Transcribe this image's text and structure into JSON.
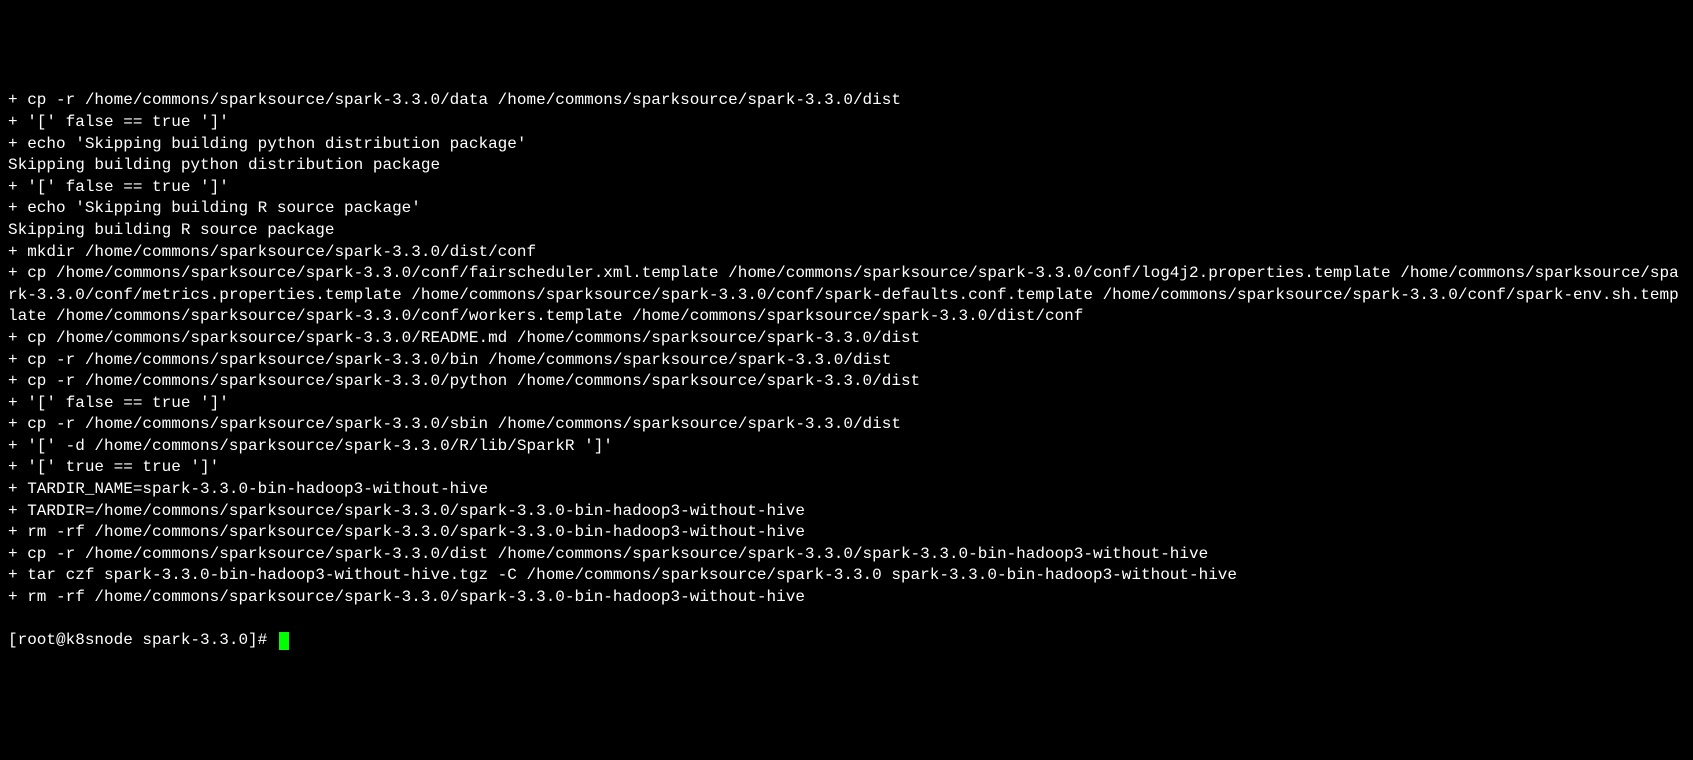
{
  "terminal": {
    "lines": [
      "+ cp -r /home/commons/sparksource/spark-3.3.0/data /home/commons/sparksource/spark-3.3.0/dist",
      "+ '[' false == true ']'",
      "+ echo 'Skipping building python distribution package'",
      "Skipping building python distribution package",
      "+ '[' false == true ']'",
      "+ echo 'Skipping building R source package'",
      "Skipping building R source package",
      "+ mkdir /home/commons/sparksource/spark-3.3.0/dist/conf",
      "+ cp /home/commons/sparksource/spark-3.3.0/conf/fairscheduler.xml.template /home/commons/sparksource/spark-3.3.0/conf/log4j2.properties.template /home/commons/sparksource/spark-3.3.0/conf/metrics.properties.template /home/commons/sparksource/spark-3.3.0/conf/spark-defaults.conf.template /home/commons/sparksource/spark-3.3.0/conf/spark-env.sh.template /home/commons/sparksource/spark-3.3.0/conf/workers.template /home/commons/sparksource/spark-3.3.0/dist/conf",
      "+ cp /home/commons/sparksource/spark-3.3.0/README.md /home/commons/sparksource/spark-3.3.0/dist",
      "+ cp -r /home/commons/sparksource/spark-3.3.0/bin /home/commons/sparksource/spark-3.3.0/dist",
      "+ cp -r /home/commons/sparksource/spark-3.3.0/python /home/commons/sparksource/spark-3.3.0/dist",
      "+ '[' false == true ']'",
      "+ cp -r /home/commons/sparksource/spark-3.3.0/sbin /home/commons/sparksource/spark-3.3.0/dist",
      "+ '[' -d /home/commons/sparksource/spark-3.3.0/R/lib/SparkR ']'",
      "+ '[' true == true ']'",
      "+ TARDIR_NAME=spark-3.3.0-bin-hadoop3-without-hive",
      "+ TARDIR=/home/commons/sparksource/spark-3.3.0/spark-3.3.0-bin-hadoop3-without-hive",
      "+ rm -rf /home/commons/sparksource/spark-3.3.0/spark-3.3.0-bin-hadoop3-without-hive",
      "+ cp -r /home/commons/sparksource/spark-3.3.0/dist /home/commons/sparksource/spark-3.3.0/spark-3.3.0-bin-hadoop3-without-hive",
      "+ tar czf spark-3.3.0-bin-hadoop3-without-hive.tgz -C /home/commons/sparksource/spark-3.3.0 spark-3.3.0-bin-hadoop3-without-hive",
      "+ rm -rf /home/commons/sparksource/spark-3.3.0/spark-3.3.0-bin-hadoop3-without-hive"
    ],
    "prompt": "[root@k8snode spark-3.3.0]# "
  }
}
